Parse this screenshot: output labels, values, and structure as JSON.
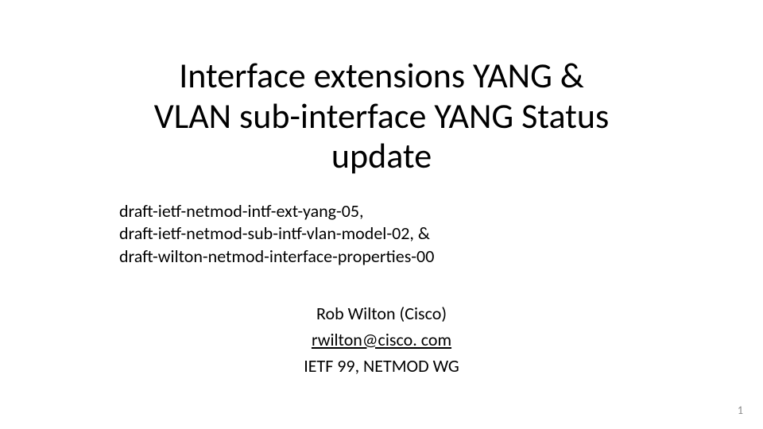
{
  "title": "Interface extensions YANG & VLAN sub-interface YANG Status update",
  "drafts": {
    "line1": "draft-ietf-netmod-intf-ext-yang-05,",
    "line2": "draft-ietf-netmod-sub-intf-vlan-model-02, &",
    "line3": "draft-wilton-netmod-interface-properties-00"
  },
  "author": {
    "name": "Rob Wilton (Cisco)",
    "email": "rwilton@cisco. com",
    "venue": "IETF 99, NETMOD WG"
  },
  "page_number": "1"
}
